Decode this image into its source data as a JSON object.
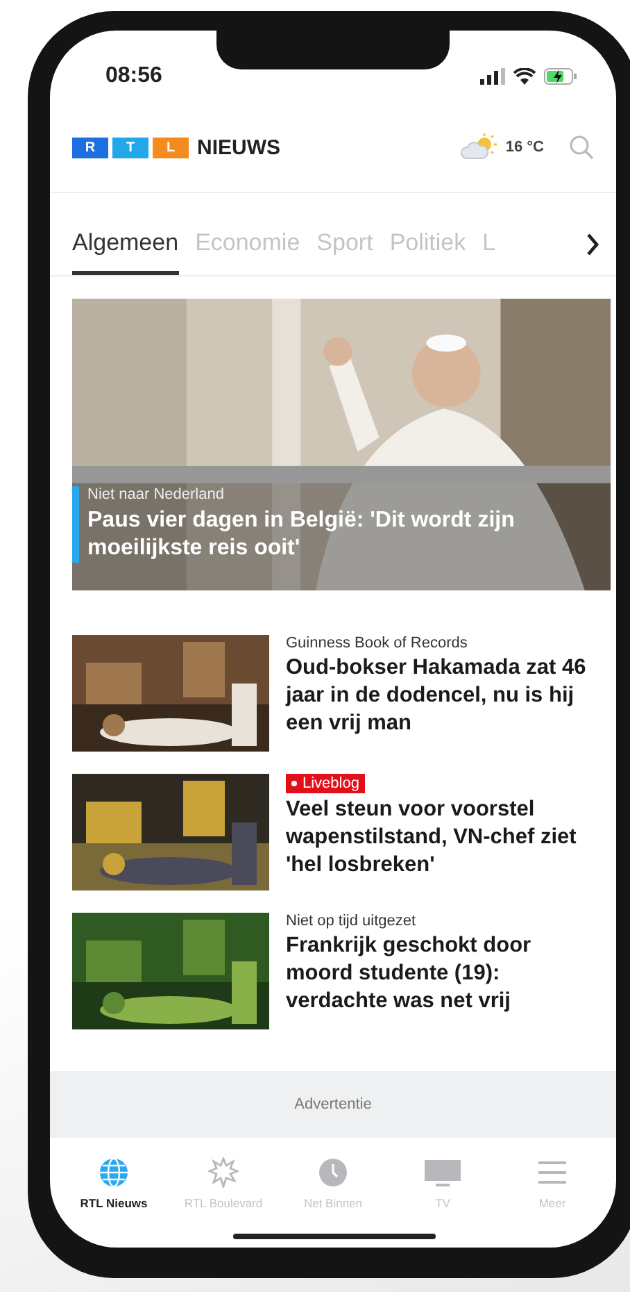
{
  "status_bar": {
    "time": "08:56"
  },
  "header": {
    "logo_letters": [
      {
        "letter": "R",
        "color": "#1e6fe0"
      },
      {
        "letter": "T",
        "color": "#22a7ea"
      },
      {
        "letter": "L",
        "color": "#f58a1f"
      }
    ],
    "brand": "NIEUWS",
    "temperature": "16 °C"
  },
  "tabs": [
    {
      "label": "Algemeen",
      "selected": true
    },
    {
      "label": "Economie",
      "selected": false
    },
    {
      "label": "Sport",
      "selected": false
    },
    {
      "label": "Politiek",
      "selected": false
    },
    {
      "label": "L",
      "selected": false
    }
  ],
  "hero": {
    "kicker": "Niet naar Nederland",
    "title": "Paus vier dagen in België: 'Dit wordt zijn moeilijkste reis ooit'"
  },
  "articles": [
    {
      "kind": "plain",
      "kicker": "Guinness Book of Records",
      "title": "Oud-bokser Hakamada zat 46 jaar in de dodencel, nu is hij een vrij man"
    },
    {
      "kind": "live",
      "kicker": "Liveblog",
      "title": "Veel steun voor voorstel wapenstilstand, VN-chef ziet 'hel losbreken'"
    },
    {
      "kind": "plain",
      "kicker": "Niet op tijd uitgezet",
      "title": "Frankrijk geschokt door moord studente (19): verdachte was net vrij"
    }
  ],
  "ad": {
    "label": "Advertentie"
  },
  "nav": [
    {
      "kind": "globe",
      "label": "RTL Nieuws",
      "selected": true
    },
    {
      "kind": "burst",
      "label": "RTL Boulevard",
      "selected": false
    },
    {
      "kind": "clock",
      "label": "Net Binnen",
      "selected": false
    },
    {
      "kind": "tv",
      "label": "TV",
      "selected": false
    },
    {
      "kind": "menu",
      "label": "Meer",
      "selected": false
    }
  ]
}
